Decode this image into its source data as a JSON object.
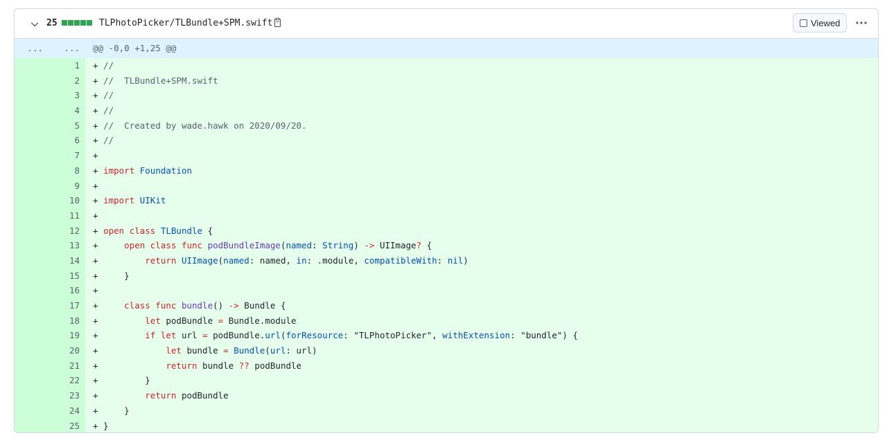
{
  "header": {
    "changes_count": "25",
    "filename": "TLPhotoPicker/TLBundle+SPM.swift",
    "viewed_label": "Viewed",
    "diffstat_blocks": 5,
    "icons": {
      "collapse": "chevron-down-icon",
      "copy": "copy-icon",
      "more": "kebab-horizontal-icon"
    }
  },
  "hunk": {
    "left_marker": "...",
    "right_marker": "...",
    "header": "@@ -0,0 +1,25 @@"
  },
  "colors": {
    "addition_bg": "#e6ffec",
    "addition_num_bg": "#ccffd8",
    "hunk_bg": "#ddf4ff",
    "diffstat_green": "#2da44e",
    "keyword": "#cf222e",
    "type": "#0550ae",
    "string": "#0a3069"
  },
  "lines": [
    {
      "n": "1",
      "tokens": [
        [
          "p",
          "+ "
        ],
        [
          "c",
          "//"
        ]
      ]
    },
    {
      "n": "2",
      "tokens": [
        [
          "p",
          "+ "
        ],
        [
          "c",
          "//  TLBundle+SPM.swift"
        ]
      ]
    },
    {
      "n": "3",
      "tokens": [
        [
          "p",
          "+ "
        ],
        [
          "c",
          "//"
        ]
      ]
    },
    {
      "n": "4",
      "tokens": [
        [
          "p",
          "+ "
        ],
        [
          "c",
          "//"
        ]
      ]
    },
    {
      "n": "5",
      "tokens": [
        [
          "p",
          "+ "
        ],
        [
          "c",
          "//  Created by wade.hawk on 2020/09/20."
        ]
      ]
    },
    {
      "n": "6",
      "tokens": [
        [
          "p",
          "+ "
        ],
        [
          "c",
          "//"
        ]
      ]
    },
    {
      "n": "7",
      "tokens": [
        [
          "p",
          "+ "
        ]
      ]
    },
    {
      "n": "8",
      "tokens": [
        [
          "p",
          "+ "
        ],
        [
          "k",
          "import"
        ],
        [
          "p",
          " "
        ],
        [
          "t",
          "Foundation"
        ]
      ]
    },
    {
      "n": "9",
      "tokens": [
        [
          "p",
          "+ "
        ]
      ]
    },
    {
      "n": "10",
      "tokens": [
        [
          "p",
          "+ "
        ],
        [
          "k",
          "import"
        ],
        [
          "p",
          " "
        ],
        [
          "t",
          "UIKit"
        ]
      ]
    },
    {
      "n": "11",
      "tokens": [
        [
          "p",
          "+ "
        ]
      ]
    },
    {
      "n": "12",
      "tokens": [
        [
          "p",
          "+ "
        ],
        [
          "k",
          "open class"
        ],
        [
          "p",
          " "
        ],
        [
          "t",
          "TLBundle"
        ],
        [
          "p",
          " {"
        ]
      ]
    },
    {
      "n": "13",
      "tokens": [
        [
          "p",
          "+     "
        ],
        [
          "k",
          "open class func"
        ],
        [
          "p",
          " "
        ],
        [
          "f",
          "podBundleImage"
        ],
        [
          "p",
          "("
        ],
        [
          "t",
          "named"
        ],
        [
          "p",
          ": "
        ],
        [
          "t",
          "String"
        ],
        [
          "p",
          ") "
        ],
        [
          "o",
          "->"
        ],
        [
          "p",
          " UIImage"
        ],
        [
          "o",
          "?"
        ],
        [
          "p",
          " {"
        ]
      ]
    },
    {
      "n": "14",
      "tokens": [
        [
          "p",
          "+         "
        ],
        [
          "k",
          "return"
        ],
        [
          "p",
          " "
        ],
        [
          "t",
          "UIImage"
        ],
        [
          "p",
          "("
        ],
        [
          "t",
          "named"
        ],
        [
          "p",
          ": named, "
        ],
        [
          "t",
          "in"
        ],
        [
          "p",
          ": .module, "
        ],
        [
          "t",
          "compatibleWith"
        ],
        [
          "p",
          ": "
        ],
        [
          "t",
          "nil"
        ],
        [
          "p",
          ")"
        ]
      ]
    },
    {
      "n": "15",
      "tokens": [
        [
          "p",
          "+     }"
        ]
      ]
    },
    {
      "n": "16",
      "tokens": [
        [
          "p",
          "+ "
        ]
      ]
    },
    {
      "n": "17",
      "tokens": [
        [
          "p",
          "+     "
        ],
        [
          "k",
          "class func"
        ],
        [
          "p",
          " "
        ],
        [
          "f",
          "bundle"
        ],
        [
          "p",
          "() "
        ],
        [
          "o",
          "->"
        ],
        [
          "p",
          " Bundle {"
        ]
      ]
    },
    {
      "n": "18",
      "tokens": [
        [
          "p",
          "+         "
        ],
        [
          "k",
          "let"
        ],
        [
          "p",
          " podBundle "
        ],
        [
          "o",
          "="
        ],
        [
          "p",
          " Bundle.module"
        ]
      ]
    },
    {
      "n": "19",
      "tokens": [
        [
          "p",
          "+         "
        ],
        [
          "k",
          "if let"
        ],
        [
          "p",
          " url "
        ],
        [
          "o",
          "="
        ],
        [
          "p",
          " podBundle."
        ],
        [
          "t",
          "url"
        ],
        [
          "p",
          "("
        ],
        [
          "t",
          "forResource"
        ],
        [
          "p",
          ": \"TLPhotoPicker\", "
        ],
        [
          "t",
          "withExtension"
        ],
        [
          "p",
          ": \"bundle\") {"
        ]
      ]
    },
    {
      "n": "20",
      "tokens": [
        [
          "p",
          "+             "
        ],
        [
          "k",
          "let"
        ],
        [
          "p",
          " bundle "
        ],
        [
          "o",
          "="
        ],
        [
          "p",
          " "
        ],
        [
          "t",
          "Bundle"
        ],
        [
          "p",
          "("
        ],
        [
          "t",
          "url"
        ],
        [
          "p",
          ": url)"
        ]
      ]
    },
    {
      "n": "21",
      "tokens": [
        [
          "p",
          "+             "
        ],
        [
          "k",
          "return"
        ],
        [
          "p",
          " bundle "
        ],
        [
          "o",
          "??"
        ],
        [
          "p",
          " podBundle"
        ]
      ]
    },
    {
      "n": "22",
      "tokens": [
        [
          "p",
          "+         }"
        ]
      ]
    },
    {
      "n": "23",
      "tokens": [
        [
          "p",
          "+         "
        ],
        [
          "k",
          "return"
        ],
        [
          "p",
          " podBundle"
        ]
      ]
    },
    {
      "n": "24",
      "tokens": [
        [
          "p",
          "+     }"
        ]
      ]
    },
    {
      "n": "25",
      "tokens": [
        [
          "p",
          "+ }"
        ]
      ]
    }
  ]
}
